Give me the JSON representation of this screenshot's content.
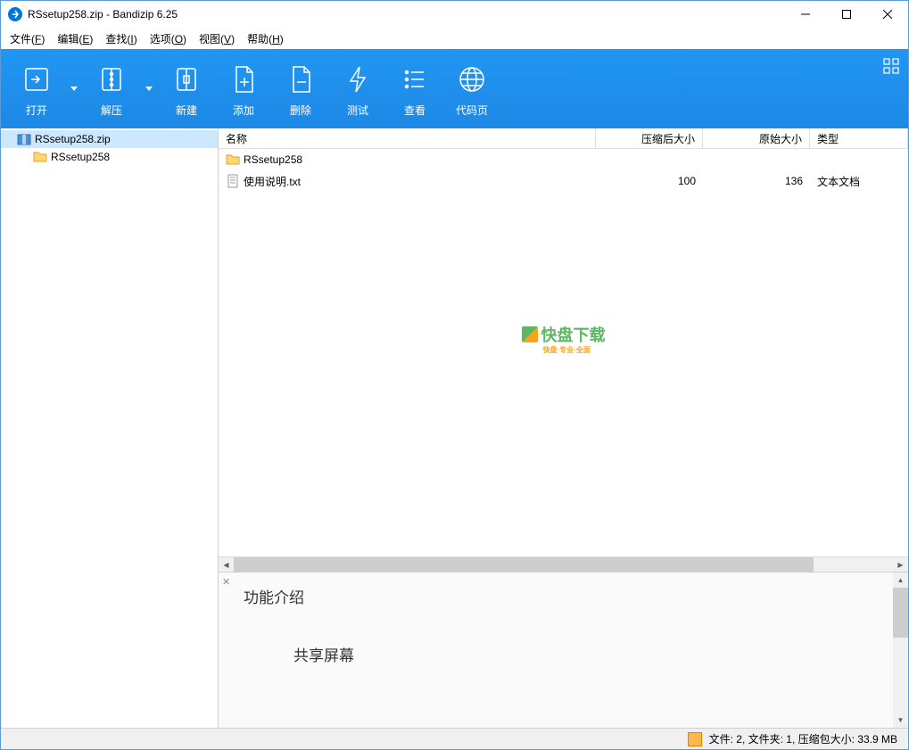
{
  "titlebar": {
    "icon_glyph": "↻",
    "title": "RSsetup258.zip - Bandizip 6.25"
  },
  "menubar": {
    "items": [
      {
        "label": "文件",
        "key": "F"
      },
      {
        "label": "编辑",
        "key": "E"
      },
      {
        "label": "查找",
        "key": "I"
      },
      {
        "label": "选项",
        "key": "O"
      },
      {
        "label": "视图",
        "key": "V"
      },
      {
        "label": "帮助",
        "key": "H"
      }
    ]
  },
  "toolbar": {
    "items": [
      {
        "id": "open",
        "label": "打开",
        "has_dropdown": true
      },
      {
        "id": "extract",
        "label": "解压",
        "has_dropdown": true
      },
      {
        "id": "new",
        "label": "新建",
        "has_dropdown": false
      },
      {
        "id": "add",
        "label": "添加",
        "has_dropdown": false
      },
      {
        "id": "delete",
        "label": "删除",
        "has_dropdown": false
      },
      {
        "id": "test",
        "label": "测试",
        "has_dropdown": false
      },
      {
        "id": "view",
        "label": "查看",
        "has_dropdown": false
      },
      {
        "id": "codepage",
        "label": "代码页",
        "has_dropdown": false
      }
    ]
  },
  "sidebar": {
    "root": {
      "name": "RSsetup258.zip"
    },
    "children": [
      {
        "name": "RSsetup258"
      }
    ]
  },
  "list": {
    "columns": {
      "name": "名称",
      "compressed": "压缩后大小",
      "original": "原始大小",
      "type": "类型"
    },
    "rows": [
      {
        "name": "RSsetup258",
        "compressed": "",
        "original": "",
        "type": "",
        "kind": "folder"
      },
      {
        "name": "使用说明.txt",
        "compressed": "100",
        "original": "136",
        "type": "文本文档",
        "kind": "text"
      }
    ]
  },
  "watermark": {
    "text": "快盘下载",
    "sub": "快盘·专业·全面"
  },
  "preview": {
    "title": "功能介绍",
    "body": "共享屏幕"
  },
  "statusbar": {
    "text": "文件: 2, 文件夹: 1, 压缩包大小: 33.9 MB"
  }
}
